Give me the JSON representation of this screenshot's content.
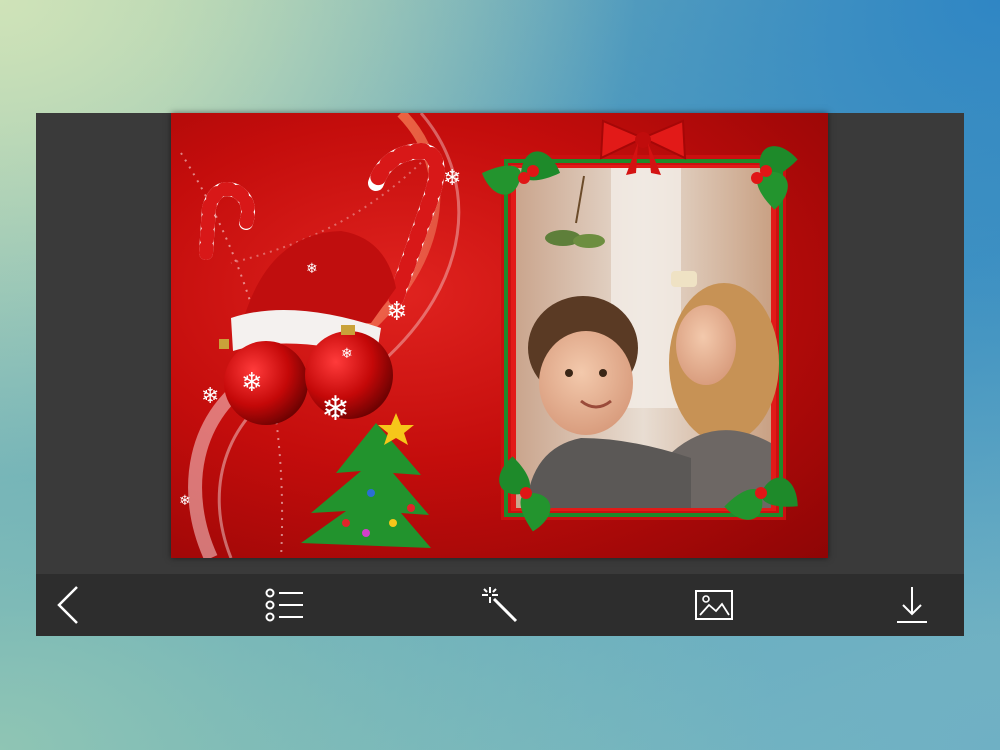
{
  "app": {
    "canvas": {
      "frame_theme": "christmas-photo-frame",
      "photo_subject": "two-children-under-mistletoe"
    },
    "toolbar": {
      "items": [
        {
          "icon": "chevron-left-icon",
          "action": "back"
        },
        {
          "icon": "list-icon",
          "action": "frames-list"
        },
        {
          "icon": "magic-wand-icon",
          "action": "effects"
        },
        {
          "icon": "image-icon",
          "action": "gallery"
        },
        {
          "icon": "download-icon",
          "action": "save"
        }
      ]
    },
    "colors": {
      "background_red": "#c40d0c",
      "frame_green": "#1f8a2a",
      "toolbar": "#2d2d2d",
      "panel": "#3a3a3a",
      "icon": "#ffffff"
    }
  }
}
